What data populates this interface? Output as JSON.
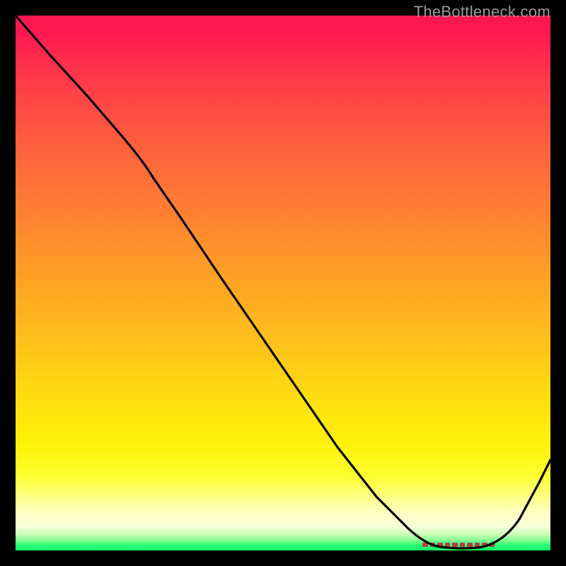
{
  "watermark": "TheBottleneck.com",
  "chart_data": {
    "type": "line",
    "title": "",
    "xlabel": "",
    "ylabel": "",
    "xlim": [
      0,
      100
    ],
    "ylim": [
      0,
      100
    ],
    "series": [
      {
        "name": "bottleneck-curve",
        "x": [
          0,
          10,
          20,
          25,
          30,
          40,
          50,
          60,
          70,
          78,
          80,
          82,
          84,
          86,
          88,
          92,
          96,
          100
        ],
        "y": [
          100,
          89,
          78,
          73,
          64,
          52,
          41,
          29,
          17,
          6,
          3,
          1,
          0.5,
          0.3,
          0.8,
          4,
          10,
          18
        ]
      }
    ],
    "optimal_range": {
      "x_start": 77,
      "x_end": 89,
      "y": 0.5
    },
    "gradient_stops": [
      {
        "pos": 0,
        "color": "#ff1850"
      },
      {
        "pos": 50,
        "color": "#ffa425"
      },
      {
        "pos": 86,
        "color": "#ffff30"
      },
      {
        "pos": 100,
        "color": "#0aff6c"
      }
    ]
  }
}
